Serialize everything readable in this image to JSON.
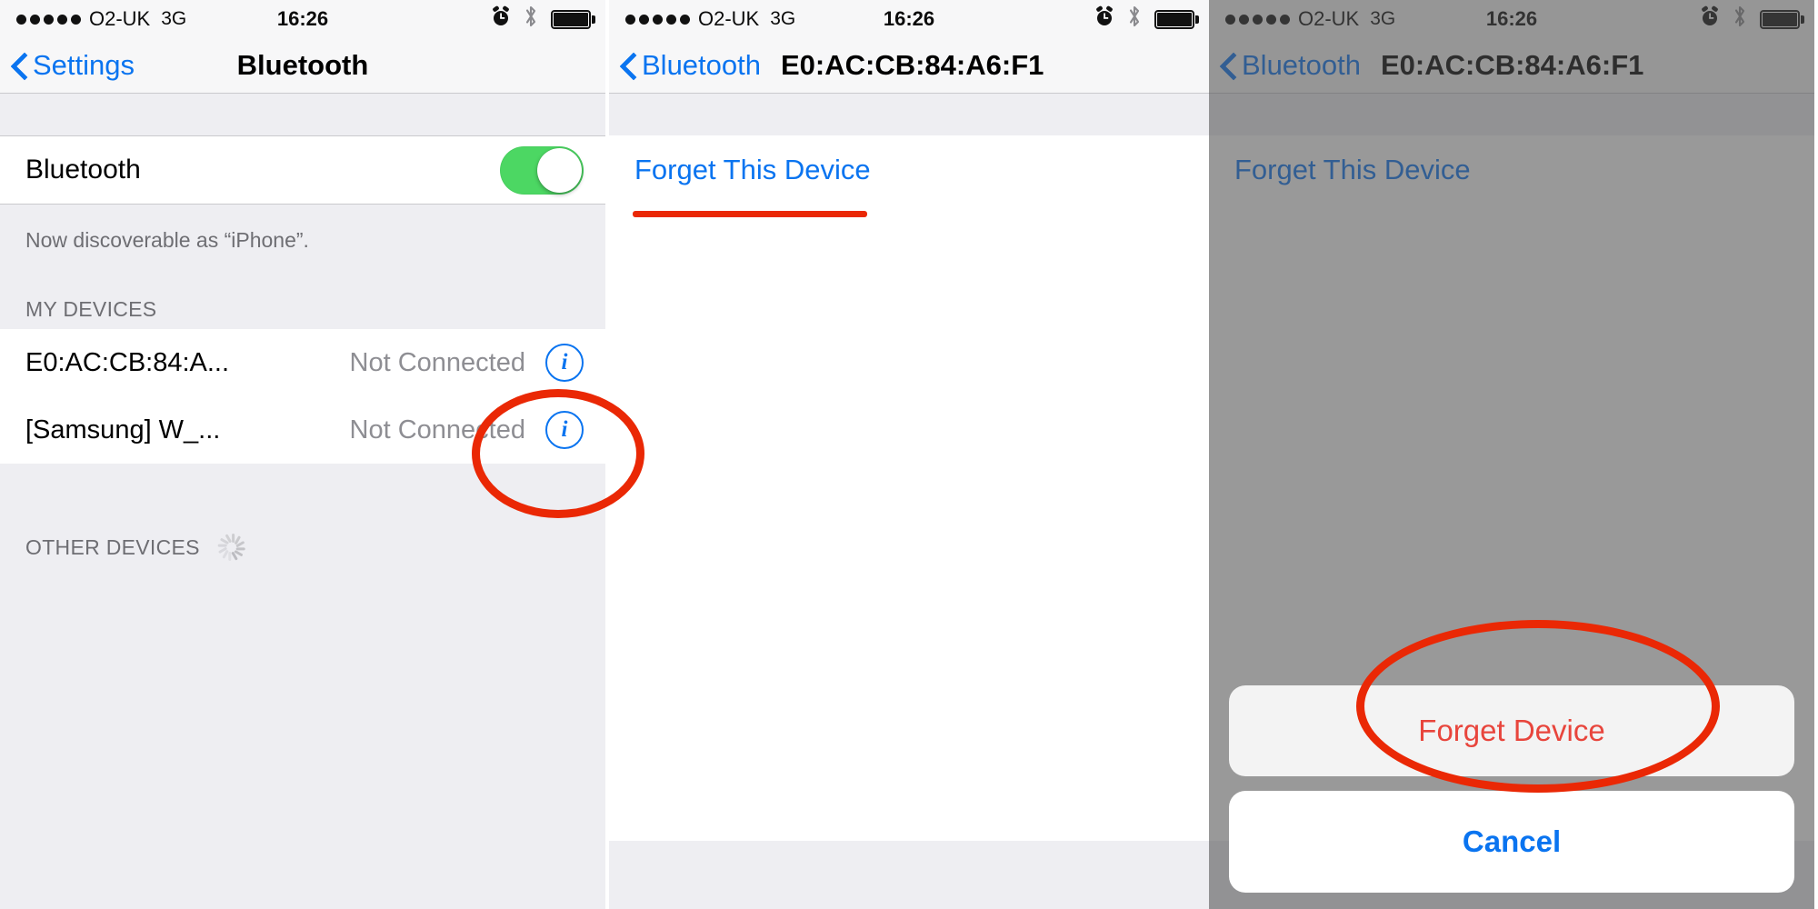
{
  "status_bar": {
    "signal_dots": 5,
    "carrier": "O2-UK",
    "network": "3G",
    "time": "16:26",
    "icons": [
      "alarm-clock-icon",
      "bluetooth-icon",
      "battery-icon"
    ]
  },
  "colors": {
    "accent_blue": "#0a74f0",
    "annotation_red": "#ea2805",
    "destructive_red": "#e8453c",
    "toggle_green": "#4cd763",
    "group_bg": "#eeeef2",
    "secondary_text": "#8e8e93"
  },
  "panel1": {
    "nav": {
      "back_label": "Settings",
      "title": "Bluetooth"
    },
    "bluetooth_row": {
      "label": "Bluetooth",
      "toggle_state": "on"
    },
    "footnote": "Now discoverable as “iPhone”.",
    "my_devices_header": "MY DEVICES",
    "devices": [
      {
        "name": "E0:AC:CB:84:A...",
        "status": "Not Connected",
        "info": "i"
      },
      {
        "name": "[Samsung] W_...",
        "status": "Not Connected",
        "info": "i"
      }
    ],
    "other_devices_header": "OTHER DEVICES"
  },
  "panel2": {
    "nav": {
      "back_label": "Bluetooth",
      "title": "E0:AC:CB:84:A6:F1"
    },
    "forget_link": "Forget This Device"
  },
  "panel3": {
    "nav": {
      "back_label": "Bluetooth",
      "title": "E0:AC:CB:84:A6:F1"
    },
    "forget_link": "Forget This Device",
    "action_sheet": {
      "destructive_label": "Forget Device",
      "cancel_label": "Cancel"
    }
  },
  "annotations": [
    {
      "type": "ellipse",
      "target": "info-button-first-device"
    },
    {
      "type": "underline",
      "target": "forget-this-device-link"
    },
    {
      "type": "ellipse",
      "target": "forget-device-sheet-button"
    }
  ]
}
